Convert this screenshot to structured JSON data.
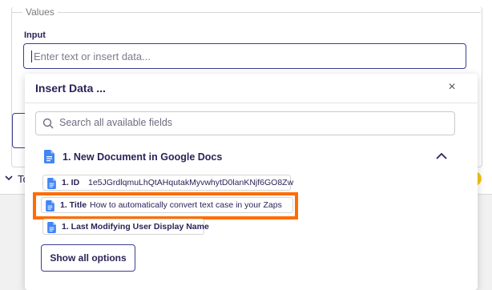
{
  "values_section": {
    "legend": "Values",
    "input_label": "Input",
    "input_placeholder": "Enter text or insert data...",
    "bottom_row_text": "To",
    "warning_badge": "!"
  },
  "insert_data": {
    "title": "Insert Data ...",
    "close_label": "×",
    "search_placeholder": "Search all available fields",
    "group": {
      "label": "1. New Document in Google Docs",
      "expanded": true
    },
    "fields": [
      {
        "key": "1. ID",
        "value": "1e5JGrdlqmuLhQtAHqutakMyvwhytD0lanKNjf6GO8Zw"
      },
      {
        "key": "1. Title",
        "value": "How to automatically convert text case in your Zaps"
      },
      {
        "key": "1. Last Modifying User Display Name",
        "value": ""
      }
    ],
    "highlighted_field_index": 1,
    "show_all_label": "Show all options"
  },
  "colors": {
    "accent": "#3b3f8f",
    "highlight": "#ff6c00",
    "google_docs_blue": "#4285f4",
    "warning": "#f5c518"
  }
}
